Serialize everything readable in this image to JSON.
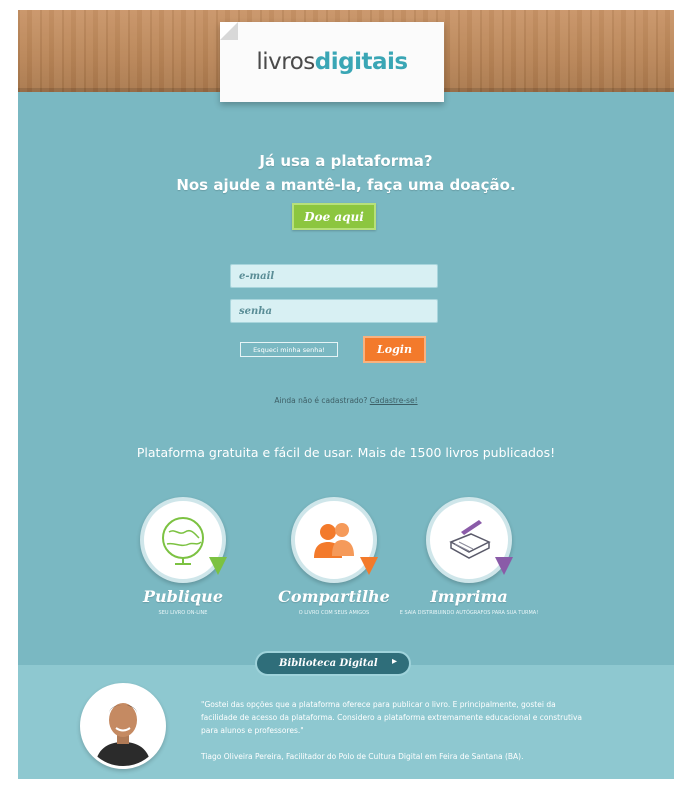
{
  "header": {
    "logo_part1": "livros",
    "logo_part2": "digitais"
  },
  "donation": {
    "line1": "Já usa a plataforma?",
    "line2": "Nos ajude a mantê-la, faça uma doação.",
    "button_label": "Doe aqui"
  },
  "login": {
    "email_placeholder": "e-mail",
    "password_placeholder": "senha",
    "forgot_label": "Esqueci minha senha!",
    "login_label": "Login",
    "signup_text": "Ainda não é cadastrado?",
    "signup_link": "Cadastre-se!"
  },
  "tagline": "Plataforma gratuita e fácil de usar. Mais de 1500 livros publicados!",
  "features": [
    {
      "title": "Publique",
      "subtitle": "SEU LIVRO ON-LINE",
      "icon": "globe-icon",
      "ribbon_color": "#7cc242"
    },
    {
      "title": "Compartilhe",
      "subtitle": "O LIVRO COM SEUS AMIGOS",
      "icon": "people-icon",
      "ribbon_color": "#f37a2b"
    },
    {
      "title": "Imprima",
      "subtitle": "E SAIA DISTRIBUINDO AUTÓGRAFOS PARA SUA TURMA!",
      "icon": "book-pen-icon",
      "ribbon_color": "#8a5ba8"
    }
  ],
  "library_button": "Biblioteca Digital",
  "testimonial": {
    "quote": "\"Gostei das opções que a plataforma oferece para publicar o livro. E principalmente, gostei da facilidade de acesso da plataforma. Considero a plataforma extremamente educacional e construtiva para alunos e professores.\"",
    "author": "Tiago Oliveira Pereira, Facilitador do Polo de Cultura Digital em Feira de Santana (BA)."
  },
  "colors": {
    "teal_bg": "#7ab8c2",
    "green_button": "#8cc63f",
    "orange_button": "#f37a2b",
    "logo_accent": "#3aa6b5"
  }
}
